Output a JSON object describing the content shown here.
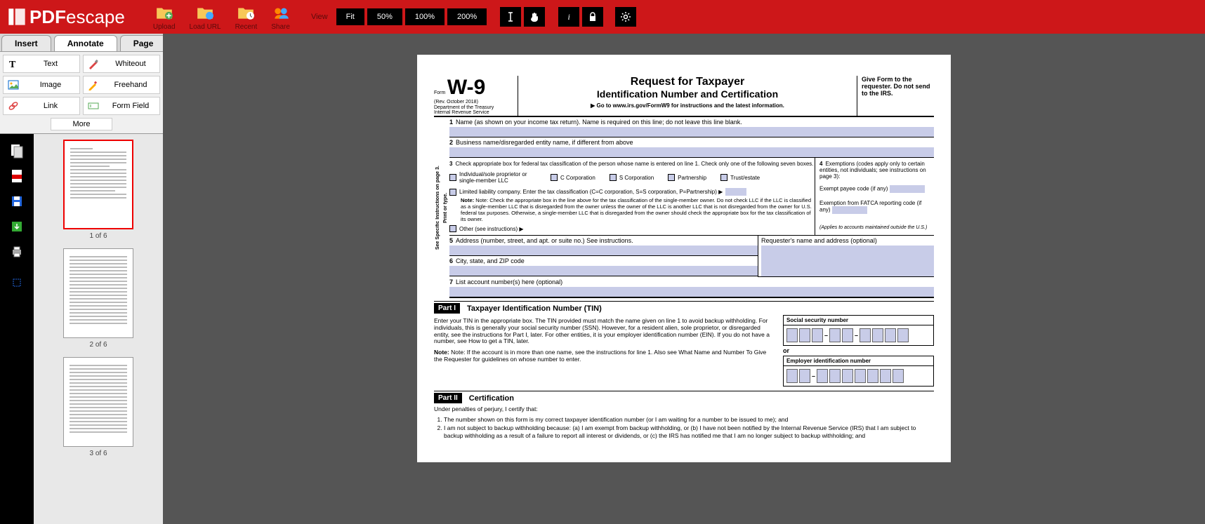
{
  "app": {
    "name_bold": "PDF",
    "name_thin": "escape"
  },
  "topbar": {
    "upload": "Upload",
    "load_url": "Load URL",
    "recent": "Recent",
    "share": "Share",
    "view": "View",
    "fit": "Fit",
    "z50": "50%",
    "z100": "100%",
    "z200": "200%"
  },
  "tabs": {
    "insert": "Insert",
    "annotate": "Annotate",
    "page": "Page"
  },
  "tools": {
    "text": "Text",
    "whiteout": "Whiteout",
    "image": "Image",
    "freehand": "Freehand",
    "link": "Link",
    "formfield": "Form Field",
    "more": "More"
  },
  "thumbs": {
    "p1": "1 of 6",
    "p2": "2 of 6",
    "p3": "3 of 6"
  },
  "w9": {
    "form_label": "Form",
    "form_code": "W-9",
    "rev": "(Rev. October 2018)",
    "dept": "Department of the Treasury",
    "irs": "Internal Revenue Service",
    "title1": "Request for Taxpayer",
    "title2": "Identification Number and Certification",
    "goto": "▶ Go to www.irs.gov/FormW9 for instructions and the latest information.",
    "give_form": "Give Form to the requester. Do not send to the IRS.",
    "side1": "Print or type.",
    "side2": "See Specific Instructions on page 3.",
    "f1": "Name (as shown on your income tax return). Name is required on this line; do not leave this line blank.",
    "f2": "Business name/disregarded entity name, if different from above",
    "f3": "Check appropriate box for federal tax classification of the person whose name is entered on line 1. Check only one of the following seven boxes.",
    "c_ind": "Individual/sole proprietor or single-member LLC",
    "c_ccorp": "C Corporation",
    "c_scorp": "S Corporation",
    "c_part": "Partnership",
    "c_trust": "Trust/estate",
    "c_llc": "Limited liability company. Enter the tax classification (C=C corporation, S=S corporation, P=Partnership) ▶",
    "llc_note": "Note: Check the appropriate box in the line above for the tax classification of the single-member owner. Do not check LLC if the LLC is classified as a single-member LLC that is disregarded from the owner unless the owner of the LLC is another LLC that is not disregarded from the owner for U.S. federal tax purposes. Otherwise, a single-member LLC that is disregarded from the owner should check the appropriate box for the tax classification of its owner.",
    "c_other": "Other (see instructions) ▶",
    "f4": "Exemptions (codes apply only to certain entities, not individuals; see instructions on page 3):",
    "f4a": "Exempt payee code (if any)",
    "f4b": "Exemption from FATCA reporting code (if any)",
    "f4c": "(Applies to accounts maintained outside the U.S.)",
    "f5": "Address (number, street, and apt. or suite no.) See instructions.",
    "f5r": "Requester's name and address (optional)",
    "f6": "City, state, and ZIP code",
    "f7": "List account number(s) here (optional)",
    "part1": "Part I",
    "part1_title": "Taxpayer Identification Number (TIN)",
    "tin_text1": "Enter your TIN in the appropriate box. The TIN provided must match the name given on line 1 to avoid backup withholding. For individuals, this is generally your social security number (SSN). However, for a resident alien, sole proprietor, or disregarded entity, see the instructions for Part I, later. For other entities, it is your employer identification number (EIN). If you do not have a number, see How to get a TIN, later.",
    "tin_note": "Note: If the account is in more than one name, see the instructions for line 1. Also see What Name and Number To Give the Requester for guidelines on whose number to enter.",
    "ssn_label": "Social security number",
    "or": "or",
    "ein_label": "Employer identification number",
    "part2": "Part II",
    "part2_title": "Certification",
    "cert_intro": "Under penalties of perjury, I certify that:",
    "cert1": "The number shown on this form is my correct taxpayer identification number (or I am waiting for a number to be issued to me); and",
    "cert2": "I am not subject to backup withholding because: (a) I am exempt from backup withholding, or (b) I have not been notified by the Internal Revenue Service (IRS) that I am subject to backup withholding as a result of a failure to report all interest or dividends, or (c) the IRS has notified me that I am no longer subject to backup withholding; and"
  }
}
